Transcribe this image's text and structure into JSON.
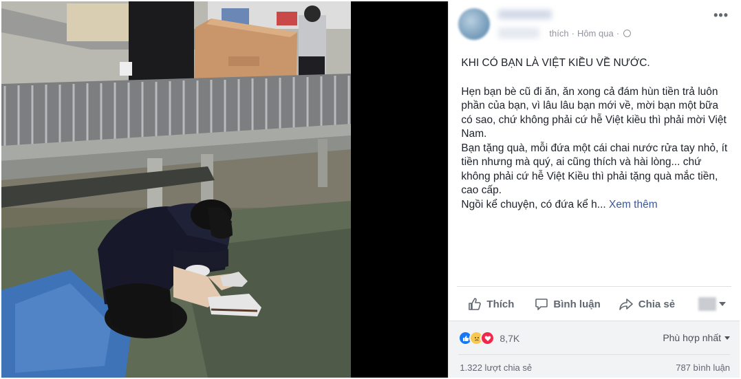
{
  "post": {
    "meta": {
      "like_word": "thích",
      "separator": "·",
      "time": "Hôm qua",
      "separator2": "·"
    },
    "more_icon": "more-horizontal-icon",
    "title": "KHI CÓ BẠN LÀ VIỆT KIỀU VỀ NƯỚC.",
    "body": [
      "Hẹn bạn bè cũ đi ăn, ăn xong cả đám hùn tiền trả luôn phần của bạn, vì lâu lâu bạn mới về, mời bạn một bữa có sao, chứ không phải cứ hễ Việt kiều thì phải mời Việt Nam.",
      "Bạn tặng quà, mỗi đứa một cái chai nước rửa tay nhỏ, ít tiền nhưng mà quý, ai cũng thích và hài lòng... chứ không phải cứ hễ Việt Kiều thì phải tặng quà mắc tiền, cao cấp."
    ],
    "last_line": "Ngồi kể chuyện, có đứa kể h...",
    "see_more": "Xem thêm"
  },
  "actions": {
    "like": "Thích",
    "comment": "Bình luận",
    "share": "Chia sẻ"
  },
  "stats": {
    "reaction_count": "8,7K",
    "sort_label": "Phù hợp nhất",
    "shares": "1.322 lượt chia sẻ",
    "comments": "787 bình luận"
  },
  "colors": {
    "link": "#385898",
    "like_blue": "#1877f2",
    "love_red": "#f0284a",
    "sad_yellow": "#f7c950"
  }
}
